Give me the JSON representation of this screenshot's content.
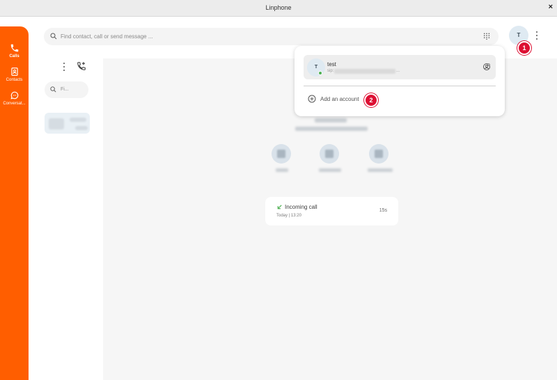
{
  "window": {
    "title": "Linphone",
    "close_label": "×"
  },
  "nav": {
    "items": [
      {
        "label": "Calls",
        "icon": "phone-icon",
        "active": true
      },
      {
        "label": "Contacts",
        "icon": "contacts-icon",
        "active": false
      },
      {
        "label": "Conversat...",
        "icon": "chat-icon",
        "active": false
      }
    ]
  },
  "topbar": {
    "search_placeholder": "Find contact, call or send message ...",
    "avatar_initial": "T",
    "badge_1": "1"
  },
  "list": {
    "search_placeholder": "Fi..."
  },
  "call_card": {
    "type": "Incoming call",
    "date": "Today | 13:20",
    "duration": "15s"
  },
  "account_popup": {
    "account": {
      "initial": "T",
      "name": "test",
      "address_prefix": "sip:",
      "address_suffix": "..."
    },
    "add_account_label": "Add an account",
    "badge_2": "2"
  },
  "colors": {
    "brand": "#ff5e00",
    "badge": "#dd1033",
    "status_online": "#4caf50",
    "call_incoming": "#4caf50"
  }
}
